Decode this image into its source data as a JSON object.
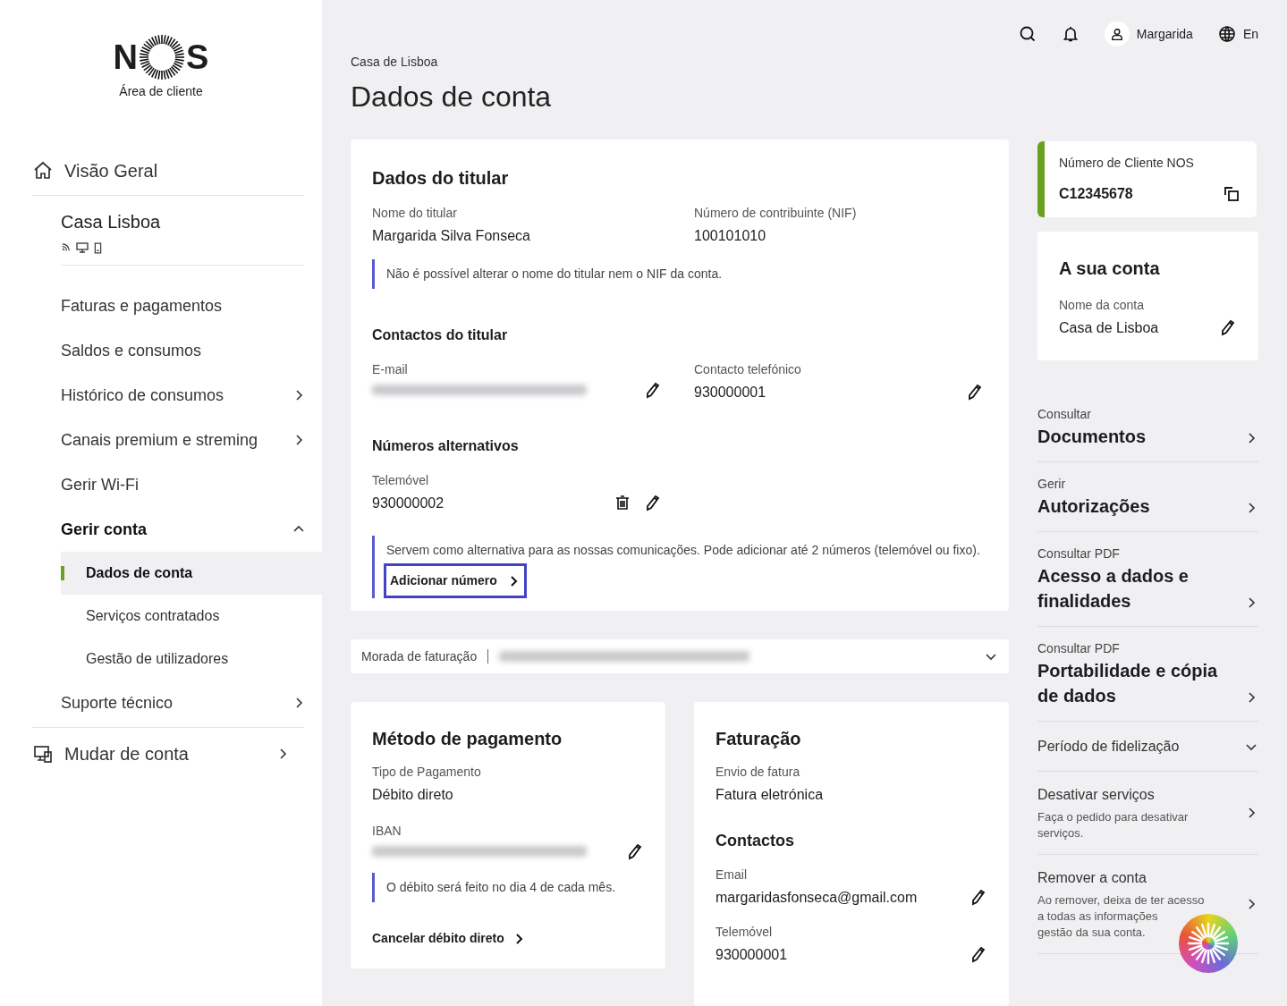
{
  "logo": {
    "letters": [
      "N",
      "S"
    ],
    "subtitle": "Área de cliente"
  },
  "sidebar": {
    "home": "Visão Geral",
    "account": "Casa Lisboa",
    "items": [
      {
        "label": "Faturas e pagamentos",
        "kind": "plain"
      },
      {
        "label": "Saldos e consumos",
        "kind": "plain"
      },
      {
        "label": "Histórico de consumos",
        "kind": "submenu",
        "expanded": false
      },
      {
        "label": "Canais premium e streming",
        "kind": "submenu",
        "expanded": false
      },
      {
        "label": "Gerir Wi-Fi",
        "kind": "plain"
      },
      {
        "label": "Gerir conta",
        "kind": "submenu",
        "expanded": true,
        "children": [
          {
            "label": "Dados de conta",
            "selected": true
          },
          {
            "label": "Serviços contratados",
            "selected": false
          },
          {
            "label": "Gestão de utilizadores",
            "selected": false
          }
        ]
      },
      {
        "label": "Suporte técnico",
        "kind": "submenu",
        "expanded": false
      }
    ],
    "switch": "Mudar de conta"
  },
  "header": {
    "user": "Margarida",
    "language": "En"
  },
  "breadcrumb": "Casa de Lisboa",
  "title": "Dados de conta",
  "holder": {
    "title": "Dados do titular",
    "fields": [
      {
        "label": "Nome do titular",
        "value": "Margarida Silva Fonseca"
      },
      {
        "label": "Número de contribuinte (NIF)",
        "value": "100101010"
      }
    ],
    "note": "Não é possível alterar o nome do titular nem o NIF da conta.",
    "contacts_title": "Contactos do titular",
    "contacts": [
      {
        "label": "E-mail",
        "redacted": true,
        "editable": true
      },
      {
        "label": "Contacto telefónico",
        "value": "930000001",
        "editable": true
      }
    ],
    "alt_title": "Números alternativos",
    "alt_numbers": [
      {
        "label": "Telemóvel",
        "value": "930000002",
        "deletable": true,
        "editable": true
      }
    ],
    "alt_note": "Servem como alternativa para as nossas comunicações. Pode adicionar até 2 números (telemóvel ou fixo).",
    "add_link": {
      "label": "Adicionar número",
      "focused": true
    }
  },
  "address": {
    "label": "Morada de faturação",
    "redacted": true,
    "expanded": false
  },
  "payment": {
    "title": "Método de pagamento",
    "fields": [
      {
        "label": "Tipo de Pagamento",
        "value": "Débito direto",
        "editable": false
      },
      {
        "label": "IBAN",
        "redacted": true,
        "editable": true
      }
    ],
    "note": "O débito será feito no dia 4 de cada mês.",
    "link": "Cancelar débito direto"
  },
  "billing": {
    "title": "Faturação",
    "fields": [
      {
        "label": "Envio de fatura",
        "value": "Fatura eletrónica",
        "editable": false
      }
    ],
    "contacts_title": "Contactos",
    "contacts": [
      {
        "label": "Email",
        "value": "margaridasfonseca@gmail.com",
        "editable": true
      },
      {
        "label": "Telemóvel",
        "value": "930000001",
        "editable": true
      }
    ]
  },
  "client_card": {
    "label": "Número de Cliente NOS",
    "value": "C12345678"
  },
  "account_card": {
    "title": "A sua conta",
    "label": "Nome da conta",
    "value": "Casa de Lisboa",
    "editable": true
  },
  "links": [
    {
      "kind": "link",
      "caption": "Consultar",
      "title": "Documentos"
    },
    {
      "kind": "link",
      "caption": "Gerir",
      "title": "Autorizações"
    },
    {
      "kind": "link",
      "caption": "Consultar PDF",
      "title": "Acesso a dados e finalidades"
    },
    {
      "kind": "link",
      "caption": "Consultar PDF",
      "title": "Portabilidade e cópia de dados"
    },
    {
      "kind": "dropdown",
      "title": "Período de fidelização",
      "expanded": false
    },
    {
      "kind": "detail",
      "title": "Desativar serviços",
      "description": [
        "Faça o pedido para desativar",
        "serviços."
      ]
    },
    {
      "kind": "detail",
      "title": "Remover a conta",
      "description": [
        "Ao remover, deixa de ter acesso",
        "a todas as informações",
        "gestão da sua conta."
      ]
    }
  ]
}
